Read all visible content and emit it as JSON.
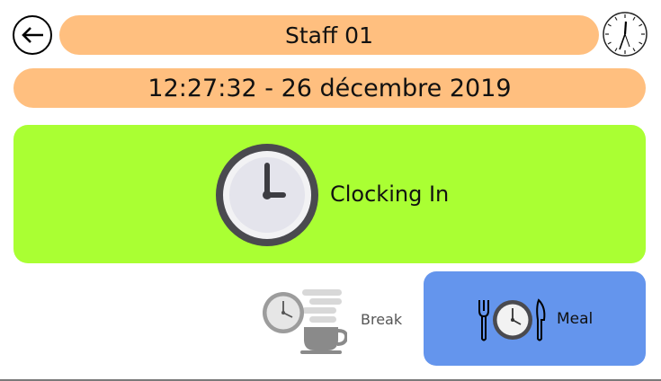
{
  "header": {
    "title": "Staff 01",
    "back_icon": "back-arrow-icon",
    "clock_icon": "analog-clock-icon"
  },
  "datetime": {
    "text": "12:27:32 - 26 décembre 2019"
  },
  "clock_in": {
    "label": "Clocking In",
    "icon": "clock-icon",
    "color": "#aaff33"
  },
  "break": {
    "label": "Break",
    "icon": "clock-coffee-icon"
  },
  "meal": {
    "label": "Meal",
    "icon": "clock-cutlery-icon",
    "color": "#6495ed"
  },
  "colors": {
    "header_pill": "#ffbf7f"
  }
}
